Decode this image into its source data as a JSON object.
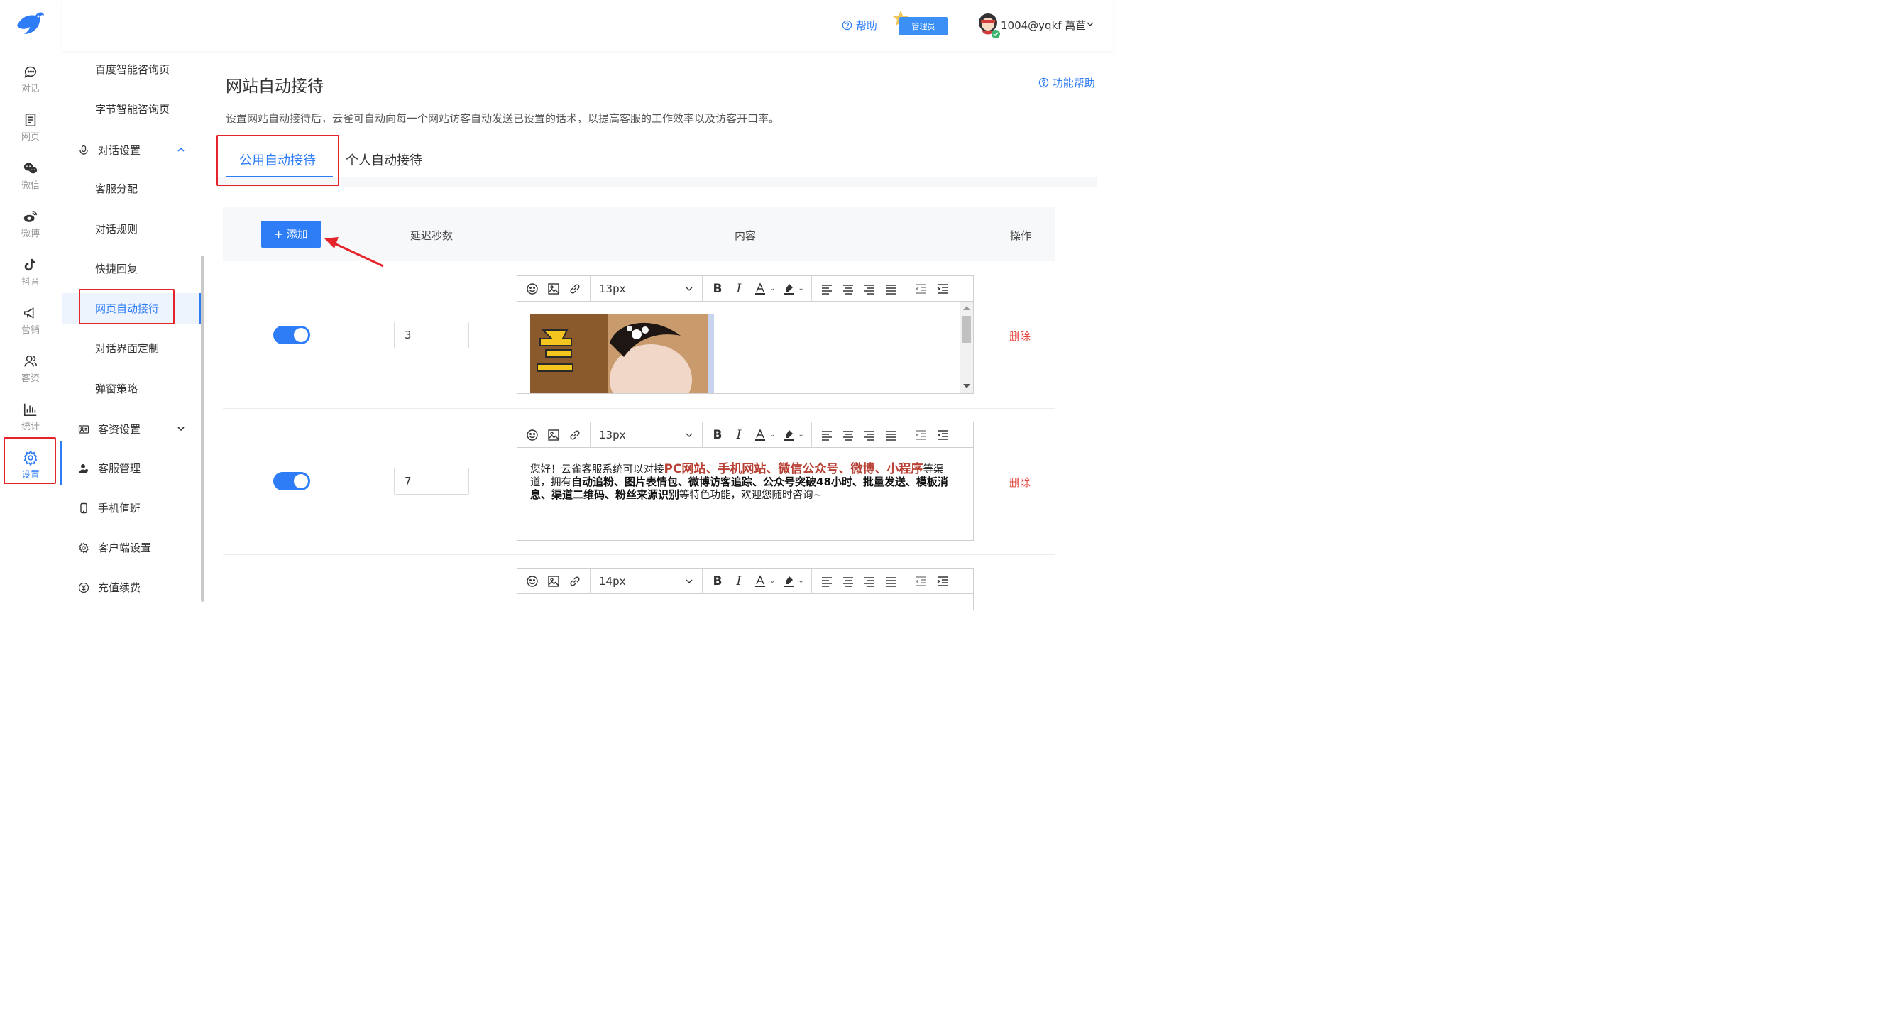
{
  "brand_color": "#2e7df6",
  "nav": {
    "items": [
      {
        "label": "对话",
        "icon": "chat-icon"
      },
      {
        "label": "网页",
        "icon": "webpage-icon"
      },
      {
        "label": "微信",
        "icon": "wechat-icon"
      },
      {
        "label": "微博",
        "icon": "weibo-icon"
      },
      {
        "label": "抖音",
        "icon": "douyin-icon"
      },
      {
        "label": "营销",
        "icon": "megaphone-icon"
      },
      {
        "label": "客资",
        "icon": "customer-icon"
      },
      {
        "label": "统计",
        "icon": "stats-icon"
      },
      {
        "label": "设置",
        "icon": "gear-icon",
        "active": true
      }
    ]
  },
  "submenu": {
    "items": [
      {
        "label": "百度智能咨询页"
      },
      {
        "label": "字节智能咨询页"
      },
      {
        "label": "对话设置",
        "icon": "microphone-icon",
        "expanded": true
      },
      {
        "label": "客服分配"
      },
      {
        "label": "对话规则"
      },
      {
        "label": "快捷回复"
      },
      {
        "label": "网页自动接待",
        "active": true
      },
      {
        "label": "对话界面定制"
      },
      {
        "label": "弹窗策略"
      },
      {
        "label": "客资设置",
        "icon": "id-card-icon",
        "expanded": false
      },
      {
        "label": "客服管理",
        "icon": "person-icon"
      },
      {
        "label": "手机值班",
        "icon": "mobile-icon"
      },
      {
        "label": "客户端设置",
        "icon": "gear-icon"
      },
      {
        "label": "充值续费",
        "icon": "yuan-icon"
      }
    ]
  },
  "header": {
    "help": "帮助",
    "admin_badge": "管理员",
    "user": "1004@yqkf 萬苣"
  },
  "page": {
    "title": "网站自动接待",
    "func_help": "功能帮助",
    "description": "设置网站自动接待后，云雀可自动向每一个网站访客自动发送已设置的话术，以提高客服的工作效率以及访客开口率。",
    "tabs": [
      {
        "label": "公用自动接待",
        "active": true
      },
      {
        "label": "个人自动接待",
        "active": false
      }
    ]
  },
  "table": {
    "add_button": "+ 添加",
    "columns": [
      "延迟秒数",
      "内容",
      "操作"
    ],
    "rows": [
      {
        "enabled": true,
        "delay": "3",
        "font_size": "13px",
        "content_type": "image",
        "delete": "删除"
      },
      {
        "enabled": true,
        "delay": "7",
        "font_size": "13px",
        "content_type": "text",
        "delete": "删除",
        "text_parts": [
          {
            "t": "您好！云雀客服系统可以对接",
            "s": "normal"
          },
          {
            "t": "PC网站、手机网站、微信公众号、微博、小程序",
            "s": "red"
          },
          {
            "t": "等渠道，拥有",
            "s": "normal"
          },
          {
            "t": "自动追粉、图片表情包、微博访客追踪、公众号突破48小时、批量发送、模板消息、渠道二维码、粉丝来源识别",
            "s": "bold"
          },
          {
            "t": "等特色功能，欢迎您随时咨询~",
            "s": "normal"
          }
        ]
      },
      {
        "enabled": true,
        "delay": "",
        "font_size": "14px",
        "content_type": "text",
        "delete": ""
      }
    ]
  }
}
